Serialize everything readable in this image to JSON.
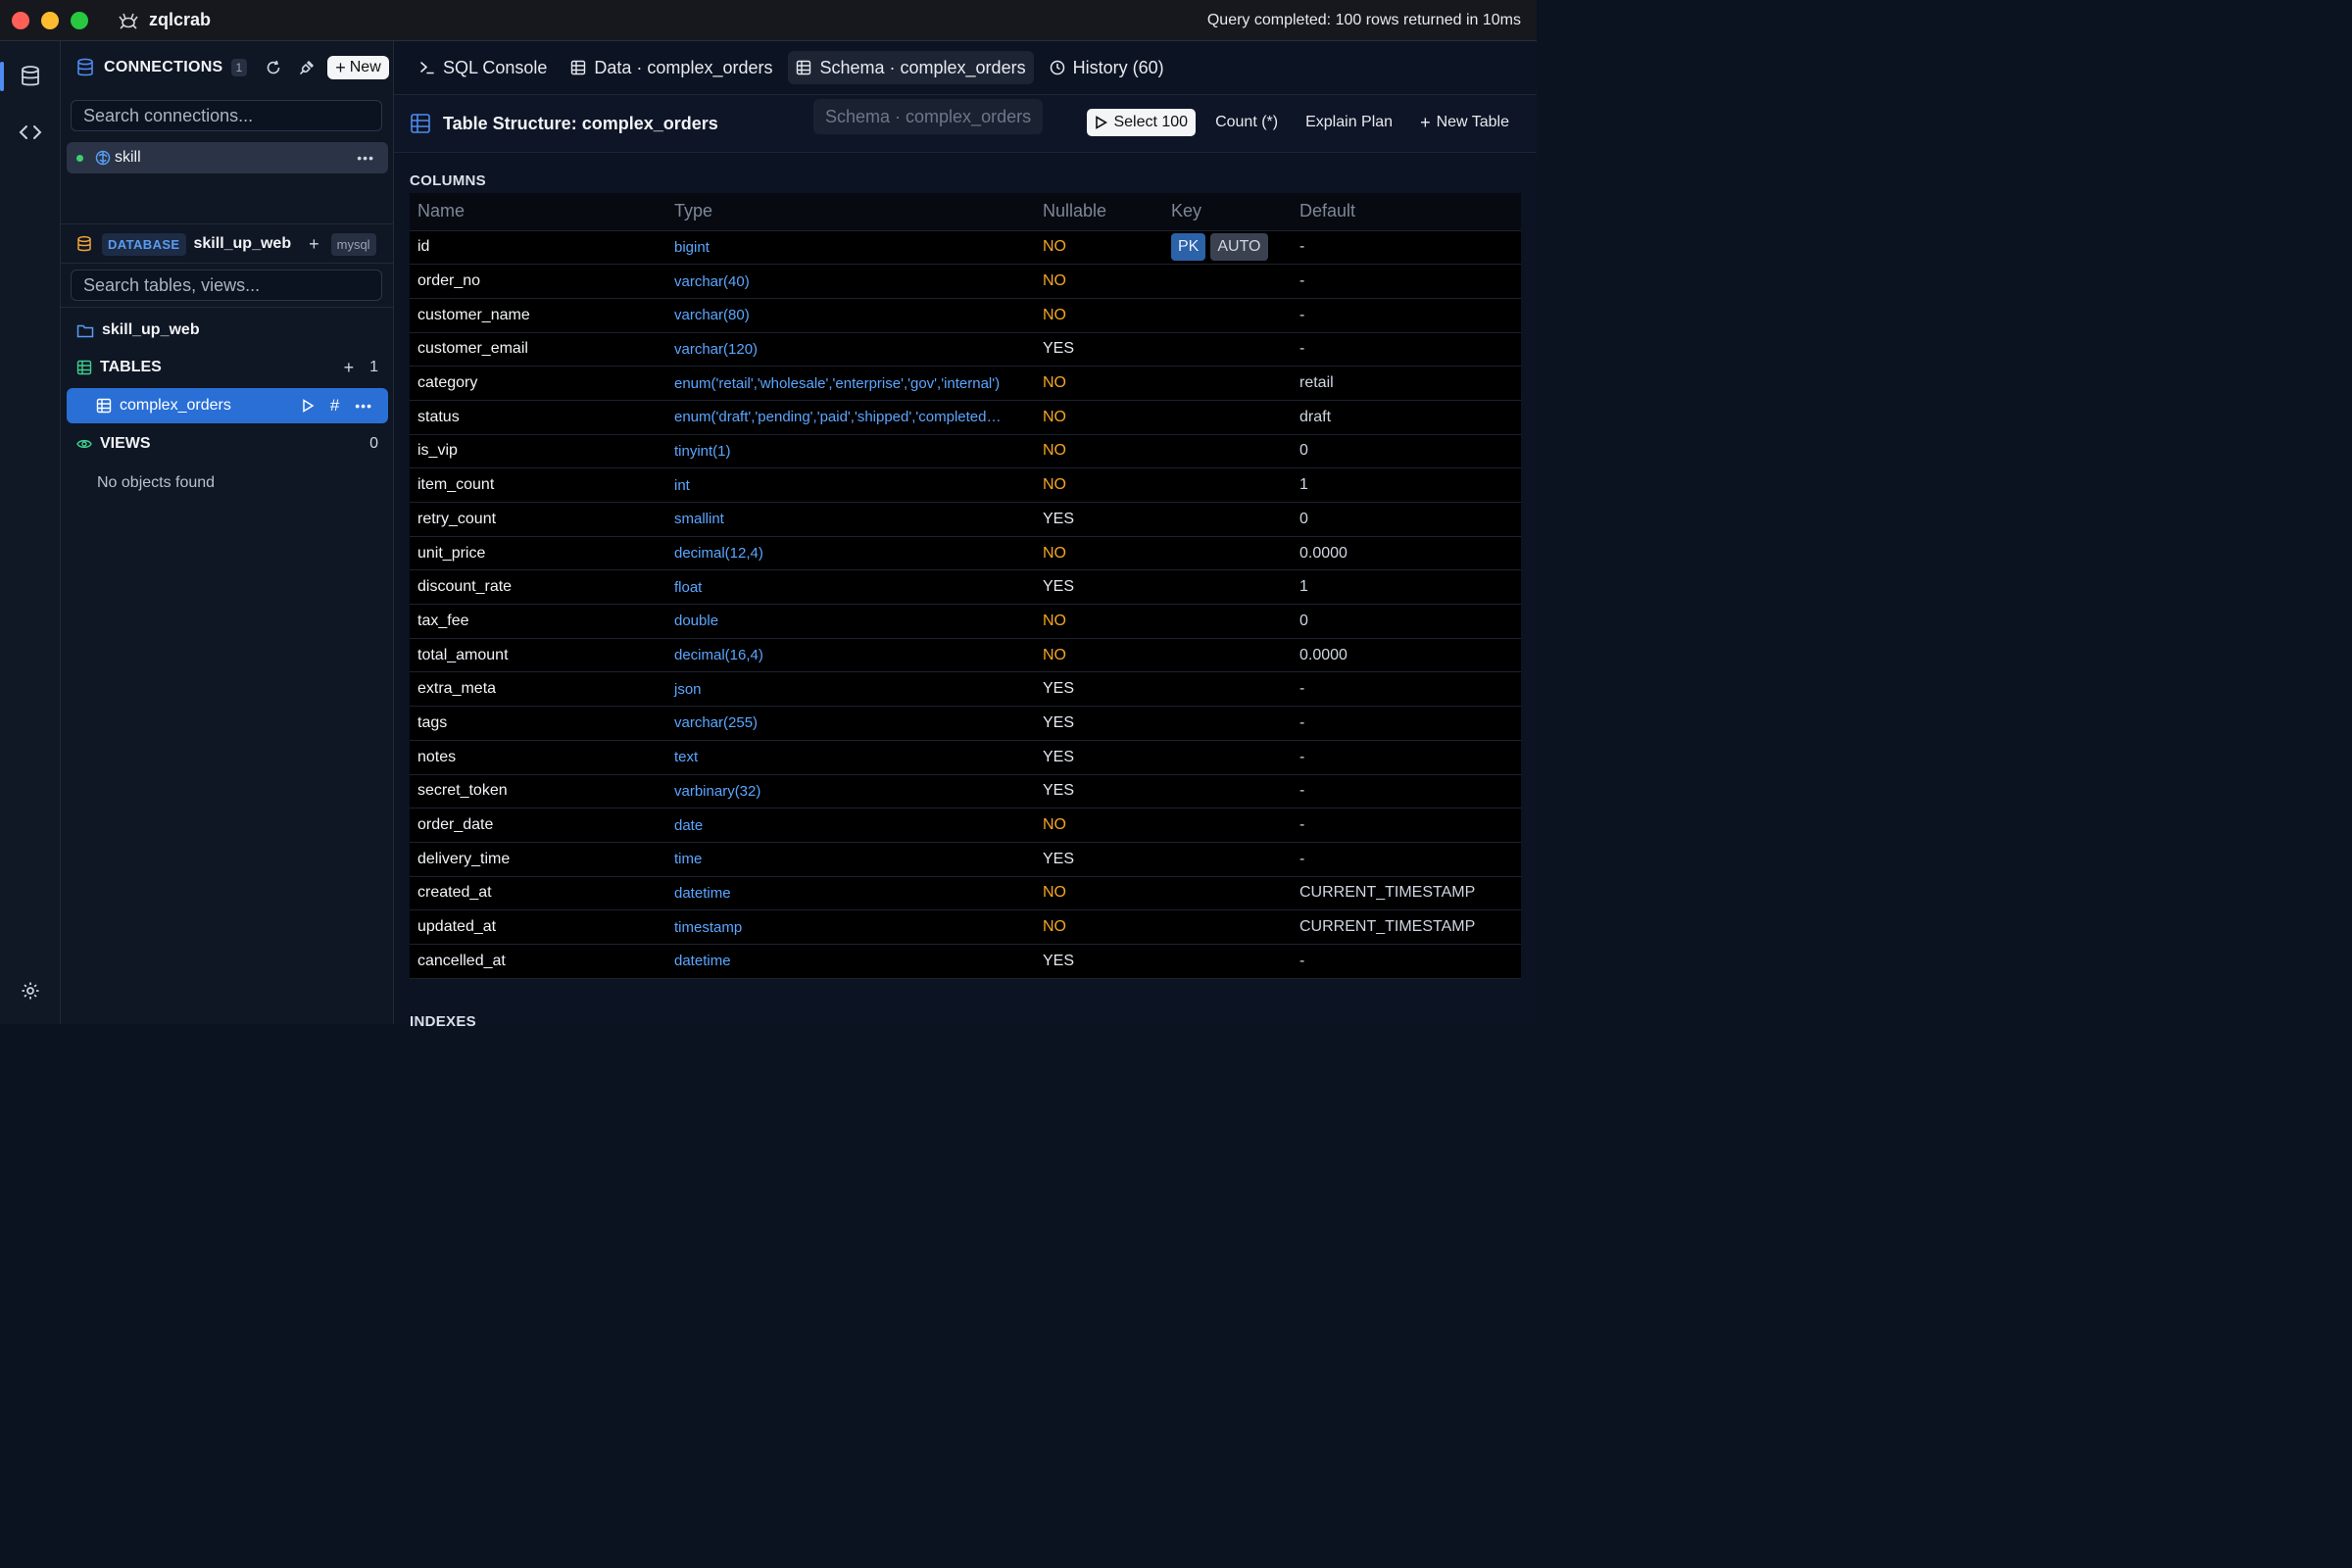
{
  "app": {
    "name": "zqlcrab",
    "status": "Query completed: 100 rows returned in 10ms"
  },
  "sidebar": {
    "connections_title": "CONNECTIONS",
    "connections_count": "1",
    "new_label": "New",
    "search_connections_placeholder": "Search connections...",
    "connection_name": "skill",
    "database_tag": "DATABASE",
    "database_name": "skill_up_web",
    "database_engine": "mysql",
    "search_tables_placeholder": "Search tables, views...",
    "schema_name": "skill_up_web",
    "tables_label": "TABLES",
    "tables_count": "1",
    "table_item": "complex_orders",
    "views_label": "VIEWS",
    "views_count": "0",
    "empty_message": "No objects found"
  },
  "tabs": [
    {
      "label": "SQL Console"
    },
    {
      "label": "Data · complex_orders"
    },
    {
      "label": "Schema · complex_orders"
    },
    {
      "label": "History (60)"
    }
  ],
  "toolbar": {
    "title": "Table Structure: complex_orders",
    "ghost_chip": "Schema · complex_orders",
    "select_label": "Select 100",
    "count_label": "Count (*)",
    "explain_label": "Explain Plan",
    "new_table_label": "New Table"
  },
  "columns_section": {
    "title": "COLUMNS",
    "headers": [
      "Name",
      "Type",
      "Nullable",
      "Key",
      "Default"
    ],
    "rows": [
      {
        "name": "id",
        "type": "bigint",
        "nullable": "NO",
        "keys": [
          "PK",
          "AUTO"
        ],
        "default": "-"
      },
      {
        "name": "order_no",
        "type": "varchar(40)",
        "nullable": "NO",
        "keys": [],
        "default": "-"
      },
      {
        "name": "customer_name",
        "type": "varchar(80)",
        "nullable": "NO",
        "keys": [],
        "default": "-"
      },
      {
        "name": "customer_email",
        "type": "varchar(120)",
        "nullable": "YES",
        "keys": [],
        "default": "-"
      },
      {
        "name": "category",
        "type": "enum('retail','wholesale','enterprise','gov','internal')",
        "nullable": "NO",
        "keys": [],
        "default": "retail"
      },
      {
        "name": "status",
        "type": "enum('draft','pending','paid','shipped','completed…",
        "nullable": "NO",
        "keys": [],
        "default": "draft"
      },
      {
        "name": "is_vip",
        "type": "tinyint(1)",
        "nullable": "NO",
        "keys": [],
        "default": "0"
      },
      {
        "name": "item_count",
        "type": "int",
        "nullable": "NO",
        "keys": [],
        "default": "1"
      },
      {
        "name": "retry_count",
        "type": "smallint",
        "nullable": "YES",
        "keys": [],
        "default": "0"
      },
      {
        "name": "unit_price",
        "type": "decimal(12,4)",
        "nullable": "NO",
        "keys": [],
        "default": "0.0000"
      },
      {
        "name": "discount_rate",
        "type": "float",
        "nullable": "YES",
        "keys": [],
        "default": "1"
      },
      {
        "name": "tax_fee",
        "type": "double",
        "nullable": "NO",
        "keys": [],
        "default": "0"
      },
      {
        "name": "total_amount",
        "type": "decimal(16,4)",
        "nullable": "NO",
        "keys": [],
        "default": "0.0000"
      },
      {
        "name": "extra_meta",
        "type": "json",
        "nullable": "YES",
        "keys": [],
        "default": "-"
      },
      {
        "name": "tags",
        "type": "varchar(255)",
        "nullable": "YES",
        "keys": [],
        "default": "-"
      },
      {
        "name": "notes",
        "type": "text",
        "nullable": "YES",
        "keys": [],
        "default": "-"
      },
      {
        "name": "secret_token",
        "type": "varbinary(32)",
        "nullable": "YES",
        "keys": [],
        "default": "-"
      },
      {
        "name": "order_date",
        "type": "date",
        "nullable": "NO",
        "keys": [],
        "default": "-"
      },
      {
        "name": "delivery_time",
        "type": "time",
        "nullable": "YES",
        "keys": [],
        "default": "-"
      },
      {
        "name": "created_at",
        "type": "datetime",
        "nullable": "NO",
        "keys": [],
        "default": "CURRENT_TIMESTAMP"
      },
      {
        "name": "updated_at",
        "type": "timestamp",
        "nullable": "NO",
        "keys": [],
        "default": "CURRENT_TIMESTAMP"
      },
      {
        "name": "cancelled_at",
        "type": "datetime",
        "nullable": "YES",
        "keys": [],
        "default": "-"
      }
    ]
  },
  "indexes_section": {
    "title": "INDEXES"
  },
  "colors": {
    "accent": "#2a6fd6",
    "type_text": "#5aa6ff",
    "nullable_no": "#f5a623",
    "pk_badge": "#2c62a8"
  }
}
